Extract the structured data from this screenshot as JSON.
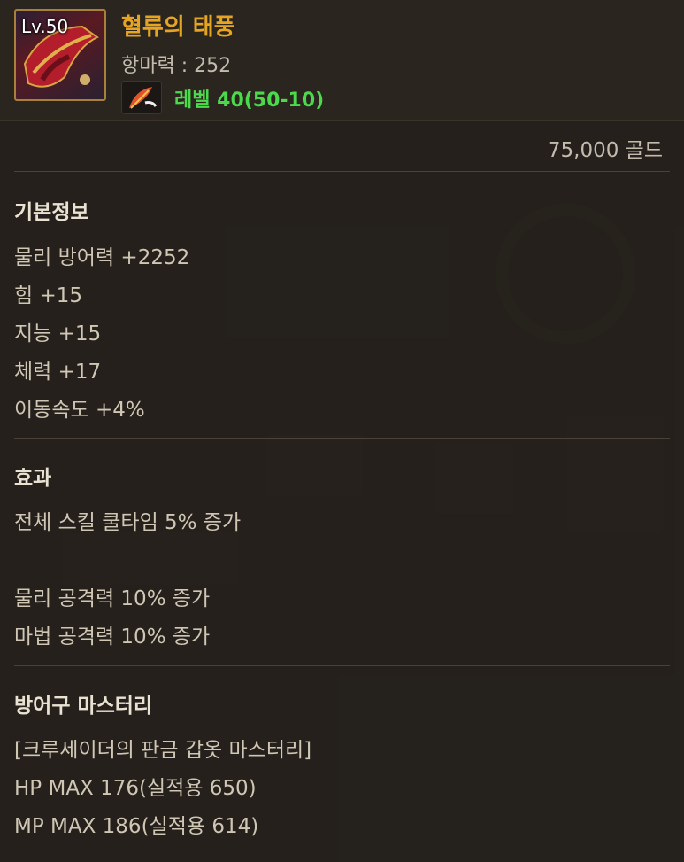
{
  "item": {
    "level_badge": "Lv.50",
    "name": "혈류의 태풍",
    "magic_resist": "항마력 : 252",
    "rune_icon": "feather-rune-icon",
    "level_requirement": "레벨 40(50-10)",
    "price": "75,000 골드"
  },
  "basic_info": {
    "title": "기본정보",
    "stats": [
      "물리 방어력 +2252",
      "힘 +15",
      "지능 +15",
      "체력 +17",
      "이동속도 +4%"
    ]
  },
  "effects": {
    "title": "효과",
    "lines": [
      "전체 스킬 쿨타임 5% 증가",
      "물리 공격력 10% 증가",
      "마법 공격력 10% 증가"
    ]
  },
  "mastery": {
    "title": "방어구 마스터리",
    "lines": [
      "[크루세이더의 판금 갑옷 마스터리]",
      "HP MAX 176(실적용 650)",
      "MP MAX 186(실적용 614)"
    ]
  },
  "colors": {
    "item_name": "#e6a423",
    "level_requirement": "#4cd94c",
    "frame": "#a8803a"
  }
}
